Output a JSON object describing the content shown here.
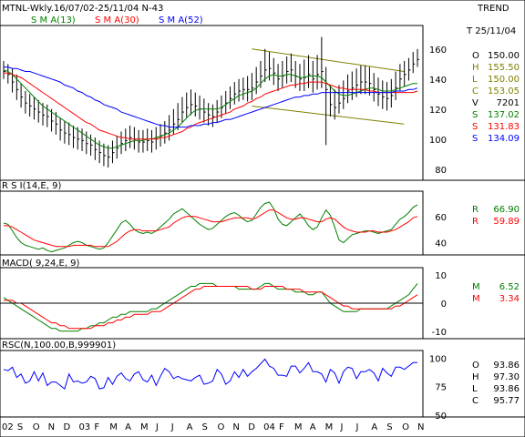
{
  "header": {
    "title": "MTNL-Wkly.16/07/02-25/11/04  N-43",
    "right_label": "TREND",
    "sma": [
      {
        "label": "S M A(13)",
        "color": "#008000"
      },
      {
        "label": "S M A(30)",
        "color": "#ff0000"
      },
      {
        "label": "S M A(52)",
        "color": "#0000ff"
      }
    ]
  },
  "x_axis": {
    "labels": [
      "02",
      "S",
      "O",
      "N",
      "D",
      "03",
      "F",
      "M",
      "A",
      "M",
      "J",
      "J",
      "A",
      "S",
      "O",
      "N",
      "D",
      "04",
      "F",
      "M",
      "A",
      "M",
      "J",
      "J",
      "A",
      "S",
      "O",
      "N"
    ]
  },
  "price_panel": {
    "date_label": "T 25/11/04",
    "y_ticks": [
      160,
      140,
      120,
      100,
      80
    ],
    "y_range": [
      75,
      172
    ],
    "readouts": [
      {
        "k": "O",
        "v": "150.00",
        "color": "#000000"
      },
      {
        "k": "H",
        "v": "155.50",
        "color": "#808000"
      },
      {
        "k": "L",
        "v": "150.00",
        "color": "#808000"
      },
      {
        "k": "C",
        "v": "153.05",
        "color": "#808000"
      },
      {
        "k": "V",
        "v": "7201",
        "color": "#000000"
      },
      {
        "k": "S",
        "v": "137.02",
        "color": "#008000"
      },
      {
        "k": "S",
        "v": "131.83",
        "color": "#ff0000"
      },
      {
        "k": "S",
        "v": "134.09",
        "color": "#0000ff"
      }
    ]
  },
  "rsi_panel": {
    "title": "R S I(14,E, 9)",
    "y_ticks": [
      60,
      40
    ],
    "readouts": [
      {
        "k": "R",
        "v": "66.90",
        "color": "#008000"
      },
      {
        "k": "R",
        "v": "59.89",
        "color": "#ff0000"
      }
    ]
  },
  "macd_panel": {
    "title": "MACD( 9,24,E, 9)",
    "y_ticks": [
      10,
      0,
      -10
    ],
    "readouts": [
      {
        "k": "M",
        "v": "6.52",
        "color": "#008000"
      },
      {
        "k": "M",
        "v": "3.34",
        "color": "#ff0000"
      }
    ]
  },
  "rsc_panel": {
    "title": "RSC(N,100.00,B,999901)",
    "y_ticks": [
      100,
      75,
      50
    ],
    "readouts": [
      {
        "k": "O",
        "v": "93.86",
        "color": "#000000"
      },
      {
        "k": "H",
        "v": "97.30",
        "color": "#000000"
      },
      {
        "k": "L",
        "v": "93.86",
        "color": "#000000"
      },
      {
        "k": "C",
        "v": "95.77",
        "color": "#000000"
      }
    ]
  },
  "chart_data": [
    {
      "type": "ohlc",
      "name": "price",
      "xlabel": "",
      "ylabel": "",
      "ylim": [
        75,
        172
      ],
      "close": [
        145,
        143,
        138,
        133,
        128,
        124,
        122,
        120,
        118,
        116,
        115,
        112,
        110,
        106,
        104,
        103,
        101,
        100,
        99,
        97,
        96,
        93,
        91,
        89,
        88,
        91,
        94,
        97,
        99,
        101,
        100,
        98,
        98,
        99,
        98,
        100,
        102,
        104,
        106,
        110,
        113,
        118,
        121,
        123,
        122,
        120,
        118,
        116,
        115,
        118,
        121,
        124,
        127,
        130,
        132,
        133,
        133,
        134,
        138,
        142,
        146,
        147,
        144,
        140,
        142,
        145,
        146,
        142,
        140,
        141,
        143,
        140,
        143,
        145,
        133,
        123,
        121,
        124,
        127,
        132,
        134,
        136,
        138,
        138,
        137,
        133,
        130,
        128,
        127,
        129,
        134,
        140,
        143,
        146,
        150,
        153
      ],
      "high": [
        152,
        150,
        147,
        143,
        137,
        132,
        130,
        128,
        126,
        124,
        123,
        120,
        118,
        114,
        112,
        111,
        109,
        108,
        107,
        105,
        103,
        101,
        99,
        97,
        96,
        99,
        102,
        105,
        107,
        109,
        108,
        106,
        106,
        107,
        106,
        108,
        110,
        112,
        116,
        120,
        124,
        128,
        131,
        133,
        131,
        129,
        127,
        124,
        123,
        126,
        129,
        132,
        135,
        138,
        140,
        141,
        142,
        144,
        148,
        152,
        160,
        158,
        154,
        150,
        152,
        155,
        157,
        152,
        150,
        153,
        156,
        152,
        156,
        168,
        148,
        136,
        133,
        136,
        139,
        143,
        145,
        147,
        149,
        149,
        148,
        144,
        141,
        139,
        138,
        140,
        145,
        150,
        152,
        154,
        158,
        160
      ],
      "low": [
        140,
        137,
        131,
        126,
        121,
        117,
        115,
        113,
        111,
        109,
        108,
        105,
        103,
        99,
        97,
        96,
        94,
        93,
        92,
        90,
        89,
        86,
        84,
        82,
        81,
        84,
        87,
        90,
        92,
        94,
        93,
        91,
        91,
        92,
        91,
        93,
        95,
        97,
        99,
        103,
        106,
        111,
        114,
        116,
        115,
        113,
        111,
        109,
        108,
        111,
        114,
        117,
        120,
        123,
        125,
        126,
        125,
        126,
        130,
        134,
        138,
        139,
        136,
        132,
        134,
        137,
        138,
        134,
        132,
        132,
        134,
        131,
        133,
        134,
        96,
        115,
        113,
        117,
        120,
        124,
        126,
        128,
        130,
        130,
        129,
        125,
        122,
        120,
        119,
        121,
        126,
        132,
        135,
        139,
        144,
        148
      ],
      "sma13": [
        146,
        145,
        143,
        140,
        137,
        134,
        131,
        128,
        125,
        122,
        120,
        118,
        116,
        114,
        112,
        110,
        108,
        106,
        104,
        102,
        100,
        98,
        96,
        95,
        94,
        94,
        95,
        96,
        97,
        98,
        99,
        99,
        99,
        100,
        100,
        101,
        102,
        103,
        104,
        106,
        108,
        111,
        114,
        117,
        119,
        120,
        120,
        120,
        120,
        120,
        121,
        123,
        125,
        127,
        129,
        130,
        131,
        132,
        134,
        137,
        140,
        142,
        143,
        142,
        142,
        143,
        143,
        142,
        141,
        141,
        142,
        142,
        142,
        141,
        138,
        135,
        132,
        130,
        129,
        129,
        130,
        131,
        132,
        133,
        134,
        134,
        133,
        132,
        132,
        132,
        133,
        134,
        135,
        136,
        137,
        137
      ],
      "sma30": [
        144,
        144,
        143,
        142,
        141,
        139,
        137,
        135,
        133,
        131,
        129,
        127,
        125,
        123,
        121,
        119,
        117,
        115,
        113,
        111,
        110,
        108,
        106,
        105,
        104,
        103,
        102,
        101,
        101,
        100,
        100,
        100,
        100,
        100,
        100,
        100,
        101,
        101,
        102,
        103,
        104,
        105,
        107,
        108,
        110,
        111,
        112,
        113,
        114,
        115,
        116,
        117,
        118,
        120,
        121,
        122,
        124,
        125,
        127,
        128,
        130,
        131,
        132,
        133,
        134,
        135,
        136,
        136,
        137,
        137,
        138,
        138,
        138,
        138,
        137,
        136,
        135,
        134,
        134,
        133,
        133,
        133,
        133,
        133,
        132,
        132,
        131,
        131,
        131,
        131,
        131,
        131,
        131,
        131,
        131,
        132
      ],
      "sma52": [
        148,
        148,
        147,
        147,
        146,
        145,
        145,
        144,
        143,
        142,
        141,
        140,
        139,
        138,
        136,
        135,
        134,
        132,
        131,
        129,
        128,
        126,
        125,
        123,
        122,
        121,
        120,
        118,
        117,
        116,
        115,
        114,
        113,
        112,
        111,
        110,
        109,
        109,
        108,
        108,
        108,
        108,
        108,
        109,
        109,
        109,
        110,
        110,
        111,
        111,
        112,
        113,
        113,
        114,
        115,
        116,
        117,
        118,
        119,
        120,
        121,
        122,
        123,
        124,
        125,
        126,
        127,
        128,
        128,
        129,
        129,
        130,
        130,
        131,
        131,
        131,
        131,
        131,
        131,
        131,
        131,
        131,
        131,
        131,
        131,
        131,
        131,
        131,
        131,
        131,
        132,
        132,
        132,
        133,
        133,
        134
      ],
      "trend_channel": [
        {
          "x1": 60,
          "y1": 160,
          "x2": 95,
          "y2": 145
        },
        {
          "x1": 60,
          "y1": 122,
          "x2": 95,
          "y2": 110
        }
      ]
    },
    {
      "type": "line",
      "name": "rsi",
      "ylim": [
        32,
        78
      ],
      "series": [
        {
          "name": "R",
          "color": "#008000",
          "values": [
            55,
            54,
            49,
            44,
            40,
            38,
            37,
            36,
            35,
            36,
            34,
            33,
            34,
            35,
            36,
            38,
            40,
            41,
            40,
            38,
            37,
            36,
            35,
            36,
            40,
            45,
            50,
            55,
            57,
            54,
            50,
            48,
            47,
            48,
            47,
            49,
            52,
            55,
            58,
            62,
            64,
            66,
            63,
            60,
            57,
            54,
            52,
            50,
            51,
            54,
            57,
            60,
            62,
            63,
            61,
            58,
            56,
            57,
            62,
            67,
            70,
            71,
            66,
            58,
            54,
            53,
            56,
            59,
            62,
            58,
            53,
            50,
            52,
            59,
            65,
            61,
            52,
            42,
            40,
            43,
            46,
            47,
            48,
            49,
            49,
            48,
            47,
            48,
            49,
            50,
            54,
            58,
            60,
            63,
            67,
            69
          ]
        },
        {
          "name": "R",
          "color": "#ff0000",
          "values": [
            53,
            53,
            52,
            50,
            48,
            46,
            44,
            42,
            41,
            40,
            39,
            38,
            37,
            37,
            37,
            37,
            38,
            38,
            38,
            38,
            38,
            37,
            37,
            37,
            37,
            39,
            41,
            44,
            47,
            49,
            50,
            50,
            49,
            49,
            49,
            49,
            50,
            51,
            52,
            55,
            57,
            59,
            60,
            60,
            60,
            59,
            58,
            57,
            56,
            56,
            56,
            57,
            58,
            59,
            59,
            59,
            59,
            58,
            59,
            61,
            63,
            65,
            65,
            63,
            61,
            59,
            58,
            58,
            59,
            59,
            58,
            57,
            56,
            56,
            58,
            59,
            58,
            55,
            52,
            50,
            49,
            48,
            48,
            48,
            49,
            49,
            48,
            48,
            48,
            49,
            50,
            52,
            54,
            56,
            59,
            60
          ]
        }
      ]
    },
    {
      "type": "line",
      "name": "macd",
      "ylim": [
        -12,
        12
      ],
      "series": [
        {
          "name": "M",
          "color": "#008000",
          "values": [
            2,
            1,
            0,
            -1,
            -2,
            -3,
            -4,
            -5,
            -6,
            -7,
            -8,
            -9,
            -9,
            -10,
            -10,
            -10,
            -10,
            -10,
            -9,
            -9,
            -8,
            -8,
            -7,
            -7,
            -6,
            -5,
            -5,
            -4,
            -4,
            -3,
            -3,
            -3,
            -3,
            -3,
            -2,
            -2,
            -1,
            0,
            1,
            2,
            3,
            4,
            5,
            6,
            6,
            7,
            7,
            7,
            7,
            6,
            6,
            6,
            6,
            6,
            5,
            5,
            5,
            5,
            5,
            6,
            7,
            7,
            6,
            5,
            5,
            5,
            5,
            4,
            4,
            4,
            3,
            3,
            4,
            4,
            2,
            0,
            -1,
            -2,
            -3,
            -3,
            -3,
            -3,
            -2,
            -2,
            -2,
            -2,
            -2,
            -2,
            -2,
            -1,
            0,
            1,
            2,
            3,
            5,
            7
          ]
        },
        {
          "name": "M",
          "color": "#ff0000",
          "values": [
            1,
            1,
            1,
            0,
            0,
            -1,
            -2,
            -3,
            -4,
            -5,
            -6,
            -7,
            -7,
            -8,
            -8,
            -9,
            -9,
            -9,
            -9,
            -9,
            -9,
            -8,
            -8,
            -8,
            -7,
            -7,
            -6,
            -6,
            -5,
            -5,
            -4,
            -4,
            -4,
            -4,
            -3,
            -3,
            -3,
            -2,
            -1,
            0,
            1,
            2,
            3,
            4,
            5,
            5,
            6,
            6,
            6,
            6,
            6,
            6,
            6,
            6,
            6,
            6,
            6,
            5,
            5,
            5,
            6,
            6,
            6,
            6,
            6,
            5,
            5,
            5,
            5,
            4,
            4,
            4,
            4,
            4,
            3,
            2,
            1,
            0,
            -1,
            -1,
            -2,
            -2,
            -2,
            -2,
            -2,
            -2,
            -2,
            -2,
            -2,
            -2,
            -1,
            -1,
            0,
            1,
            2,
            3
          ]
        }
      ]
    },
    {
      "type": "line",
      "name": "rsc",
      "ylim": [
        50,
        105
      ],
      "series": [
        {
          "name": "RSC",
          "color": "#0000ff",
          "values": [
            90,
            89,
            92,
            83,
            86,
            78,
            80,
            88,
            80,
            87,
            76,
            79,
            79,
            76,
            73,
            86,
            79,
            80,
            78,
            79,
            84,
            82,
            73,
            74,
            83,
            77,
            84,
            87,
            82,
            80,
            86,
            88,
            81,
            79,
            85,
            76,
            84,
            91,
            88,
            82,
            84,
            82,
            81,
            80,
            83,
            85,
            77,
            78,
            80,
            90,
            86,
            77,
            80,
            88,
            83,
            90,
            84,
            88,
            91,
            95,
            99,
            93,
            91,
            85,
            85,
            84,
            93,
            93,
            87,
            91,
            96,
            88,
            88,
            86,
            79,
            90,
            87,
            78,
            88,
            92,
            91,
            82,
            88,
            88,
            90,
            87,
            80,
            91,
            87,
            84,
            92,
            92,
            90,
            93,
            96,
            96
          ]
        }
      ]
    }
  ]
}
